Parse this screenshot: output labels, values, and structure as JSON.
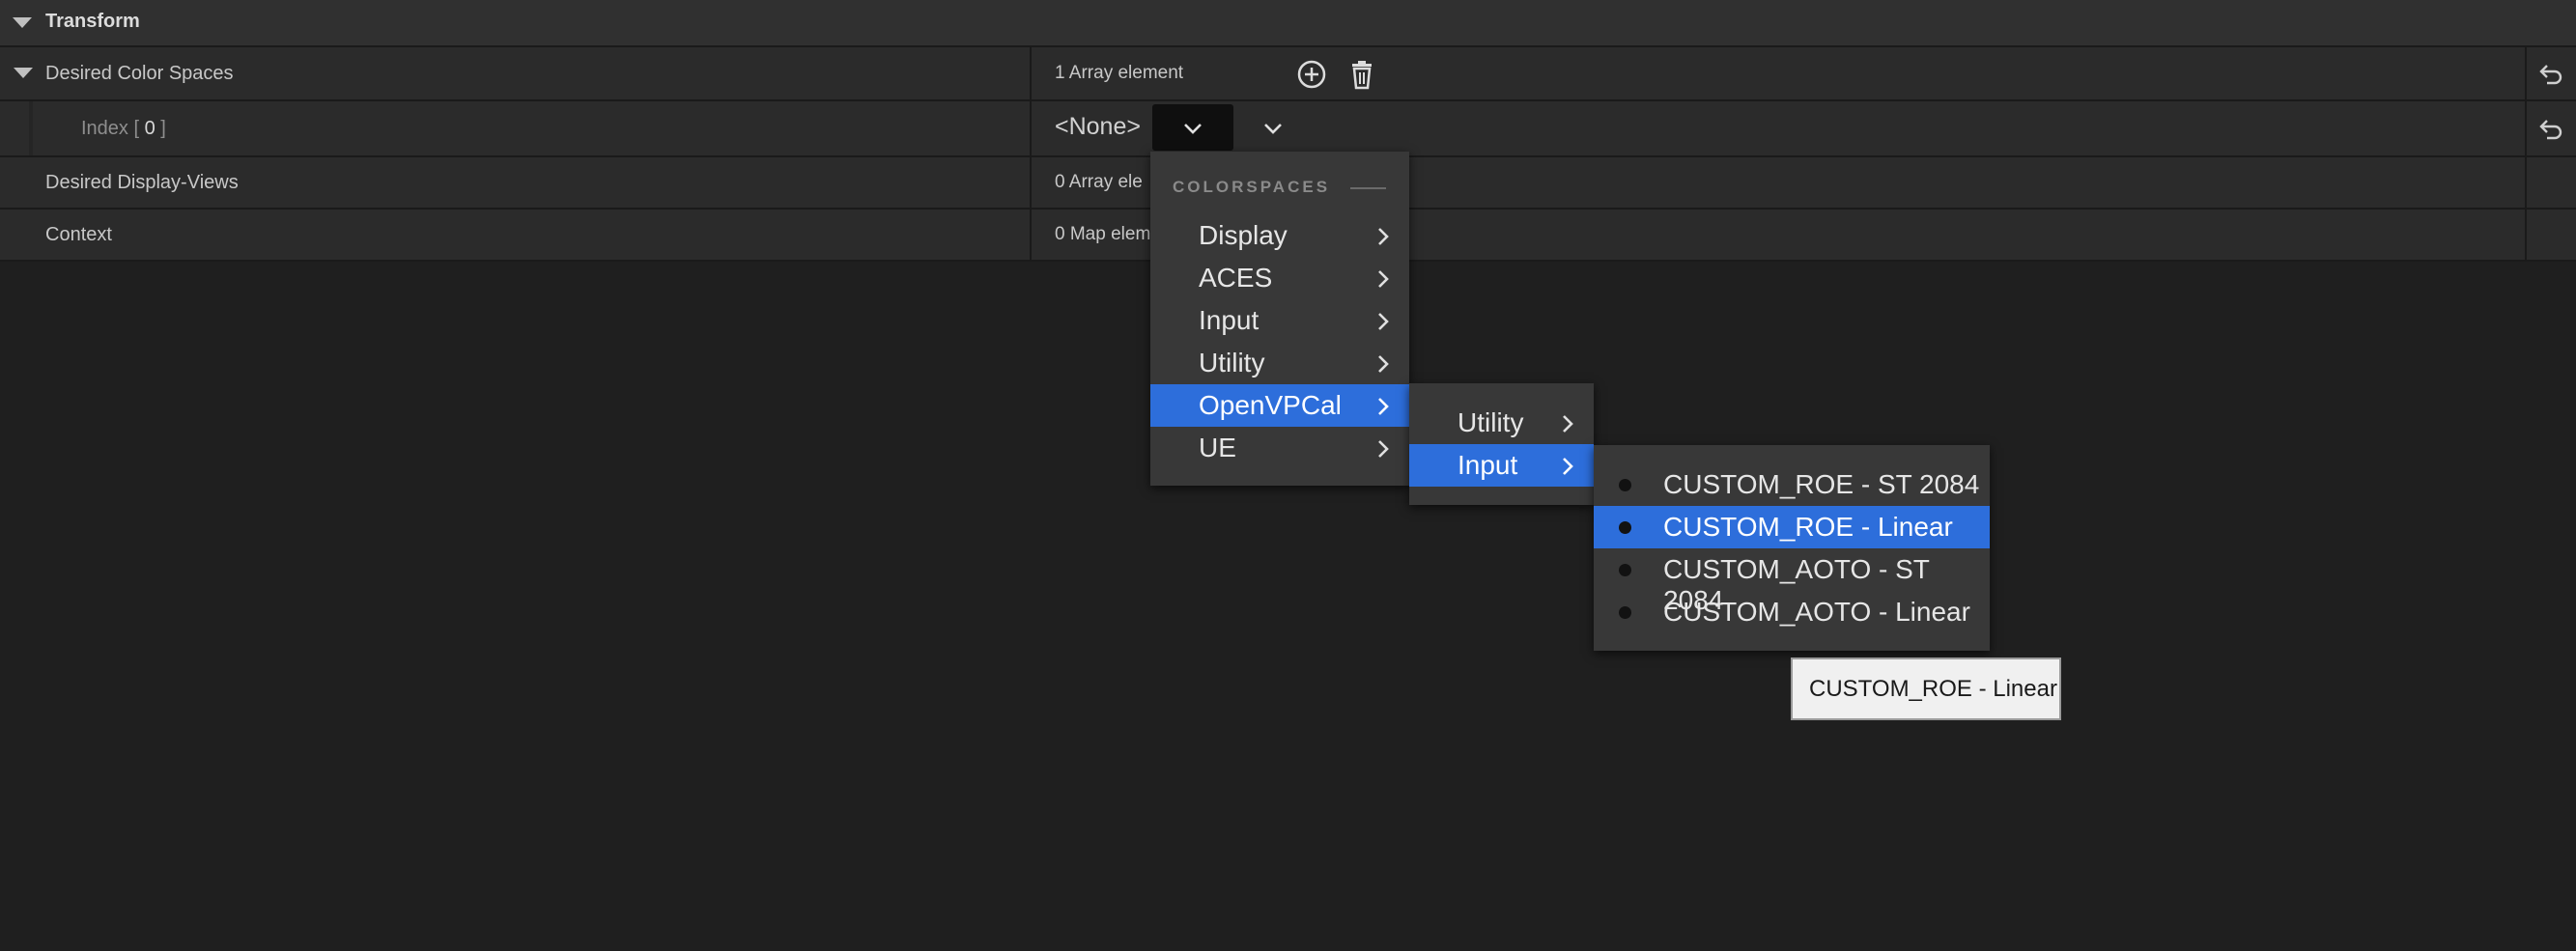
{
  "section": {
    "title": "Transform"
  },
  "rows": [
    {
      "name": "Desired Color Spaces",
      "value": "1 Array element"
    },
    {
      "name_prefix": "Index [ ",
      "name_index": "0",
      "name_suffix": " ]",
      "value": "<None>"
    },
    {
      "name": "Desired Display-Views",
      "value": "0 Array ele"
    },
    {
      "name": "Context",
      "value": "0 Map elem"
    }
  ],
  "menu": {
    "section_label": "COLORSPACES",
    "items": [
      "Display",
      "ACES",
      "Input",
      "Utility",
      "OpenVPCal",
      "UE"
    ],
    "selected": "OpenVPCal"
  },
  "submenu": {
    "items": [
      "Utility",
      "Input"
    ],
    "selected": "Input"
  },
  "submenu2": {
    "items": [
      "CUSTOM_ROE - ST 2084",
      "CUSTOM_ROE - Linear",
      "CUSTOM_AOTO - ST 2084",
      "CUSTOM_AOTO - Linear"
    ],
    "selected": "CUSTOM_ROE - Linear"
  },
  "tooltip": {
    "text": "CUSTOM_ROE - Linear"
  },
  "icons": {
    "expand": "triangle-down-icon",
    "add": "plus-circle-icon",
    "delete": "trash-icon",
    "reset": "reset-arrow-icon",
    "dropdown": "chevron-down-icon",
    "submenu": "chevron-right-icon",
    "radio": "radio-dot-icon"
  },
  "colors": {
    "background": "#1f1f1f",
    "row": "#2b2b2b",
    "menu": "#383838",
    "selection": "#2d6edb",
    "tooltip": "#f0f0f0"
  }
}
